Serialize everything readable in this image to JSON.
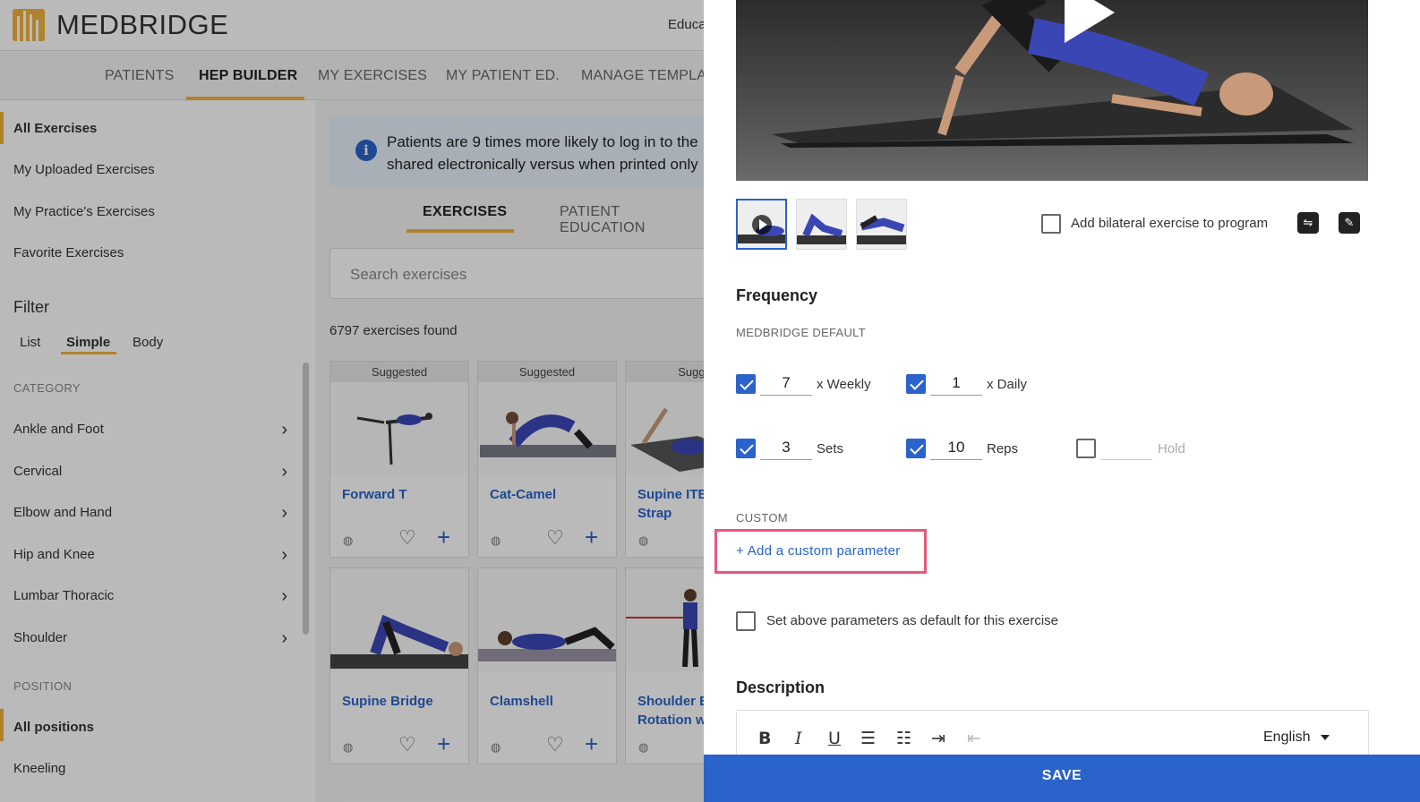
{
  "app": {
    "brand": "MEDBRIDGE",
    "top_right_partial": "Educat"
  },
  "nav": {
    "items": [
      "PATIENTS",
      "HEP BUILDER",
      "MY EXERCISES",
      "MY PATIENT ED.",
      "MANAGE TEMPLA"
    ]
  },
  "sidebar": {
    "links": [
      "All Exercises",
      "My Uploaded Exercises",
      "My Practice's Exercises",
      "Favorite Exercises"
    ],
    "filter_heading": "Filter",
    "filter_tabs": [
      "List",
      "Simple",
      "Body"
    ],
    "category_heading": "CATEGORY",
    "categories": [
      "Ankle and Foot",
      "Cervical",
      "Elbow and Hand",
      "Hip and Knee",
      "Lumbar Thoracic",
      "Shoulder"
    ],
    "position_heading": "POSITION",
    "positions": [
      "All positions",
      "Kneeling"
    ]
  },
  "main": {
    "banner_line1": "Patients are 9 times more likely to log in to the",
    "banner_line2": "shared electronically versus when printed only",
    "tabs": [
      "EXERCISES",
      "PATIENT EDUCATION"
    ],
    "search_placeholder": "Search exercises",
    "found_text": "6797 exercises found",
    "suggested_label": "Suggested",
    "suggested_partial": "Sugge",
    "cards": [
      {
        "title": "Forward T"
      },
      {
        "title": "Cat-Camel"
      },
      {
        "title": "Supine ITB with Strap"
      },
      {
        "title": "Supine Bridge"
      },
      {
        "title": "Clamshell"
      },
      {
        "title": "Shoulder E Rotation w"
      }
    ]
  },
  "panel": {
    "bilateral_label": "Add bilateral exercise to program",
    "frequency_heading": "Frequency",
    "medbridge_default_label": "MEDBRIDGE DEFAULT",
    "weekly": {
      "value": "7",
      "label": "x Weekly",
      "checked": true
    },
    "daily": {
      "value": "1",
      "label": "x Daily",
      "checked": true
    },
    "sets": {
      "value": "3",
      "label": "Sets",
      "checked": true
    },
    "reps": {
      "value": "10",
      "label": "Reps",
      "checked": true
    },
    "hold": {
      "value": "",
      "label": "Hold",
      "checked": false
    },
    "custom_label": "CUSTOM",
    "add_custom_link": "+ Add a custom parameter",
    "default_checkbox_label": "Set above parameters as default for this exercise",
    "description_heading": "Description",
    "editor": {
      "bold": "B",
      "italic": "I",
      "underline": "U",
      "language": "English"
    },
    "save_label": "SAVE"
  },
  "colors": {
    "accent": "#2a63c9",
    "brand_yellow": "#f2b33d",
    "highlight": "#e6587d"
  }
}
